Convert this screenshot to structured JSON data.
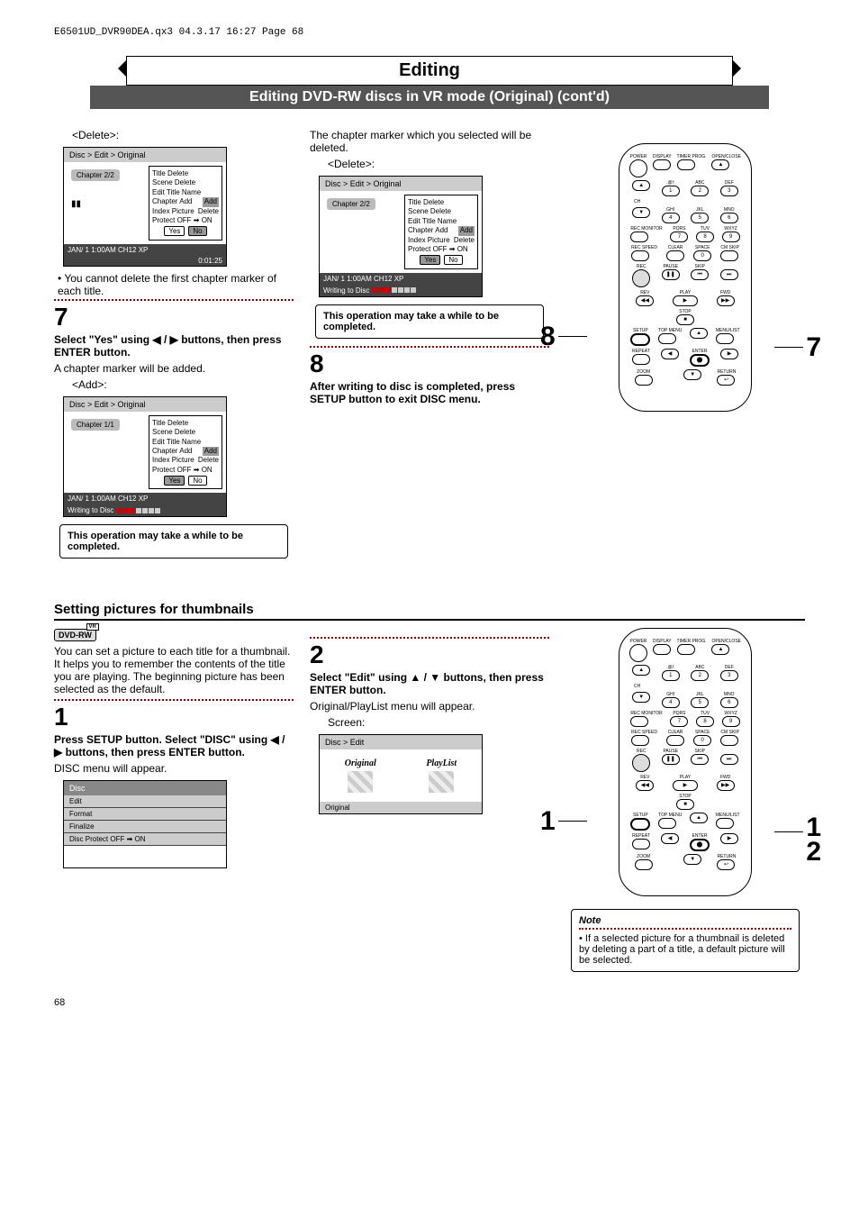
{
  "header_info": "E6501UD_DVR90DEA.qx3  04.3.17  16:27  Page 68",
  "title": "Editing",
  "subtitle": "Editing DVD-RW discs in VR mode (Original) (cont'd)",
  "col1": {
    "delete_label": "<Delete>:",
    "osd1": {
      "breadcrumb": "Disc > Edit > Original",
      "chapter": "Chapter 2/2",
      "menu": [
        "Title Delete",
        "Scene Delete",
        "Edit Title Name",
        "Chapter Add",
        "Index Picture",
        "Protect OFF ➡ ON"
      ],
      "hl_index": 3,
      "hl_sub": "Delete",
      "yes": "Yes",
      "no": "No",
      "status": "JAN/ 1   1:00AM  CH12      XP",
      "time": "0:01:25"
    },
    "note_first": "• You cannot delete the first chapter marker of each title.",
    "step7_num": "7",
    "step7_a": "Select \"Yes\" using ◀ / ▶ buttons, then press ENTER button.",
    "step7_b": "A chapter marker will be added.",
    "add_label": "<Add>:",
    "osd2": {
      "breadcrumb": "Disc > Edit > Original",
      "chapter": "Chapter 1/1",
      "menu": [
        "Title Delete",
        "Scene Delete",
        "Edit Title Name",
        "Chapter Add",
        "Index Picture",
        "Protect OFF ➡ ON"
      ],
      "hl_index": 3,
      "hl_sub": "Delete",
      "yes": "Yes",
      "no": "No",
      "status": "JAN/ 1   1:00AM  CH12      XP",
      "writing": "Writing to Disc"
    },
    "note_box": "This operation may take a while to be completed."
  },
  "col2": {
    "intro_a": "The chapter marker which you selected will be deleted.",
    "delete_label": "<Delete>:",
    "osd": {
      "breadcrumb": "Disc > Edit > Original",
      "chapter": "Chapter 2/2",
      "menu": [
        "Title Delete",
        "Scene Delete",
        "Edit Title Name",
        "Chapter Add",
        "Index Picture",
        "Protect OFF ➡ ON"
      ],
      "hl_index": 3,
      "hl_sub": "Delete",
      "yes": "Yes",
      "no": "No",
      "status": "JAN/ 1   1:00AM  CH12      XP",
      "writing": "Writing to Disc"
    },
    "note_box": "This operation may take a while to be completed.",
    "step8_num": "8",
    "step8_a": "After writing to disc is completed, press SETUP button to exit DISC menu."
  },
  "remote_call_8": "8",
  "remote_call_7": "7",
  "remote": {
    "labels": {
      "power": "POWER",
      "display": "DISPLAY",
      "timer": "TIMER PROG.",
      "open": "OPEN/CLOSE",
      "ch": "CH",
      "rec_monitor": "REC MONITOR",
      "rec_speed": "REC SPEED",
      "clear": "CLEAR",
      "space": "SPACE",
      "cm_skip": "CM SKIP",
      "rec": "REC",
      "pause": "PAUSE",
      "skip": "SKIP",
      "play": "PLAY",
      "rev": "REV",
      "stop": "STOP",
      "fwd": "FWD",
      "setup": "SETUP",
      "topmenu": "TOP MENU",
      "menulist": "MENU/LIST",
      "enter": "ENTER",
      "return": "RETURN",
      "repeat": "REPEAT",
      "zoom": "ZOOM",
      "abc": "ABC",
      "def": "DEF",
      "ghi": "GHI",
      "jkl": "JKL",
      "mno": "MNO",
      "pqrs": "PQRS",
      "tuv": "TUV",
      "wxyz": "WXYZ",
      "at": ".@/:"
    },
    "nums": [
      "1",
      "2",
      "3",
      "4",
      "5",
      "6",
      "7",
      "8",
      "9",
      "0"
    ]
  },
  "sec2": {
    "title": "Setting pictures for thumbnails",
    "badge": "DVD-RW",
    "intro": "You can set a picture to each title for a thumbnail. It helps you to remember the contents of the title you are playing. The beginning picture has been selected as the default.",
    "step1_num": "1",
    "step1_a": "Press SETUP button. Select \"DISC\" using ◀ / ▶ buttons, then press ENTER button.",
    "step1_b": "DISC menu will appear.",
    "disc_menu": {
      "head": "Disc",
      "items": [
        "Edit",
        "Format",
        "Finalize",
        "Disc Protect OFF ➡ ON"
      ]
    },
    "step2_num": "2",
    "step2_a": "Select \"Edit\" using ▲ / ▼ buttons, then press ENTER button.",
    "step2_b": "Original/PlayList menu will appear.",
    "screen_label": "Screen:",
    "disc_edit": {
      "head": "Disc > Edit",
      "left": "Original",
      "right": "PlayList",
      "foot": "Original"
    },
    "remote_call_1": "1",
    "remote_call_12a": "1",
    "remote_call_12b": "2",
    "note_title": "Note",
    "note_body": "• If a selected picture for a thumbnail is deleted by deleting a part of a title, a default picture will be selected."
  },
  "page_num": "68"
}
